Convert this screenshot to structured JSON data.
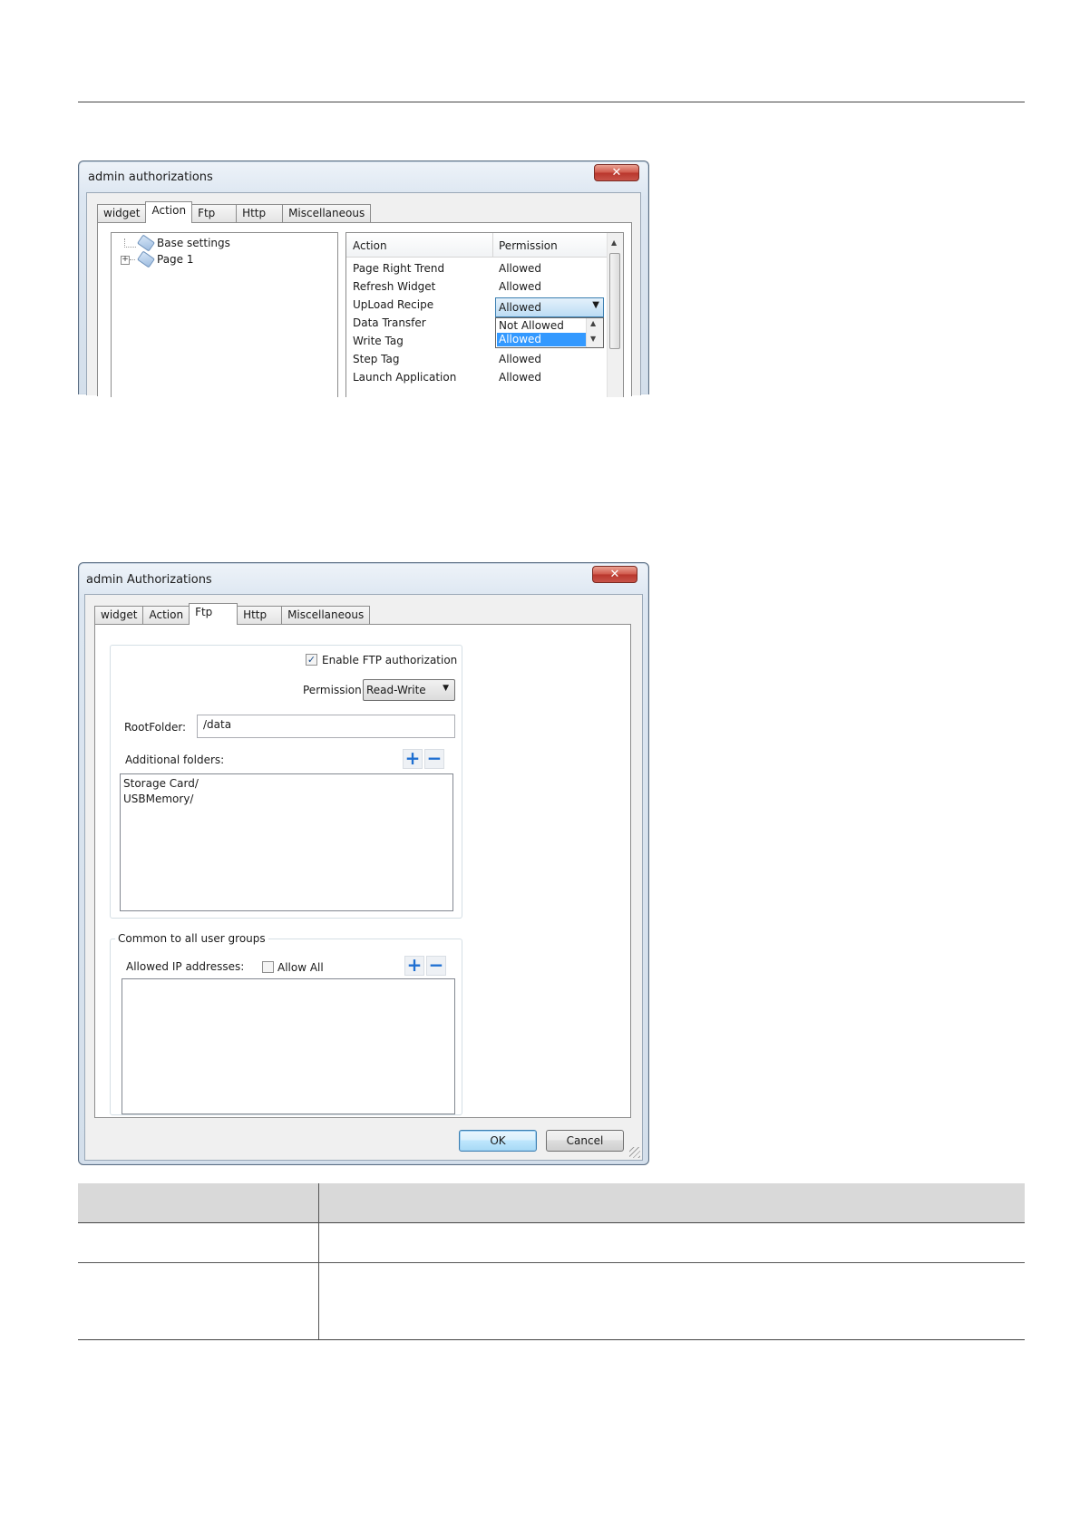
{
  "dialog1": {
    "title": "admin authorizations",
    "close_glyph": "✕",
    "tabs": [
      "widget",
      "Action",
      "Ftp",
      "Http",
      "Miscellaneous"
    ],
    "tree": [
      {
        "label": "Base settings"
      },
      {
        "label": "Page 1",
        "expander": "+"
      }
    ],
    "grid": {
      "headers": [
        "Action",
        "Permission"
      ],
      "rows": [
        {
          "action": "Page Right Trend",
          "permission": "Allowed"
        },
        {
          "action": "Refresh Widget",
          "permission": "Allowed"
        },
        {
          "action": "UpLoad Recipe",
          "permission": "Allowed"
        },
        {
          "action": "Data Transfer",
          "permission": ""
        },
        {
          "action": "Write Tag",
          "permission": ""
        },
        {
          "action": "Step Tag",
          "permission": "Allowed"
        },
        {
          "action": "Launch Application",
          "permission": "Allowed"
        }
      ],
      "combo_value": "Allowed",
      "dropdown_options": [
        "Not Allowed",
        "Allowed"
      ],
      "dropdown_selected": "Allowed"
    }
  },
  "dialog2": {
    "title": "admin Authorizations",
    "close_glyph": "✕",
    "tabs": [
      "widget",
      "Action",
      "Ftp",
      "Http",
      "Miscellaneous"
    ],
    "enable_ftp_label": "Enable FTP authorization",
    "enable_ftp_checked": "✓",
    "permission_label": "Permission:",
    "permission_value": "Read-Write",
    "root_folder_label": "RootFolder:",
    "root_folder_value": "/data",
    "additional_folders_label": "Additional folders:",
    "additional_folders": [
      "Storage Card/",
      "USBMemory/"
    ],
    "common_group_label": "Common to all user groups",
    "allowed_ip_label": "Allowed IP addresses:",
    "allow_all_label": "Allow All",
    "plus_glyph": "+",
    "minus_glyph": "−",
    "ok_label": "OK",
    "cancel_label": "Cancel"
  }
}
